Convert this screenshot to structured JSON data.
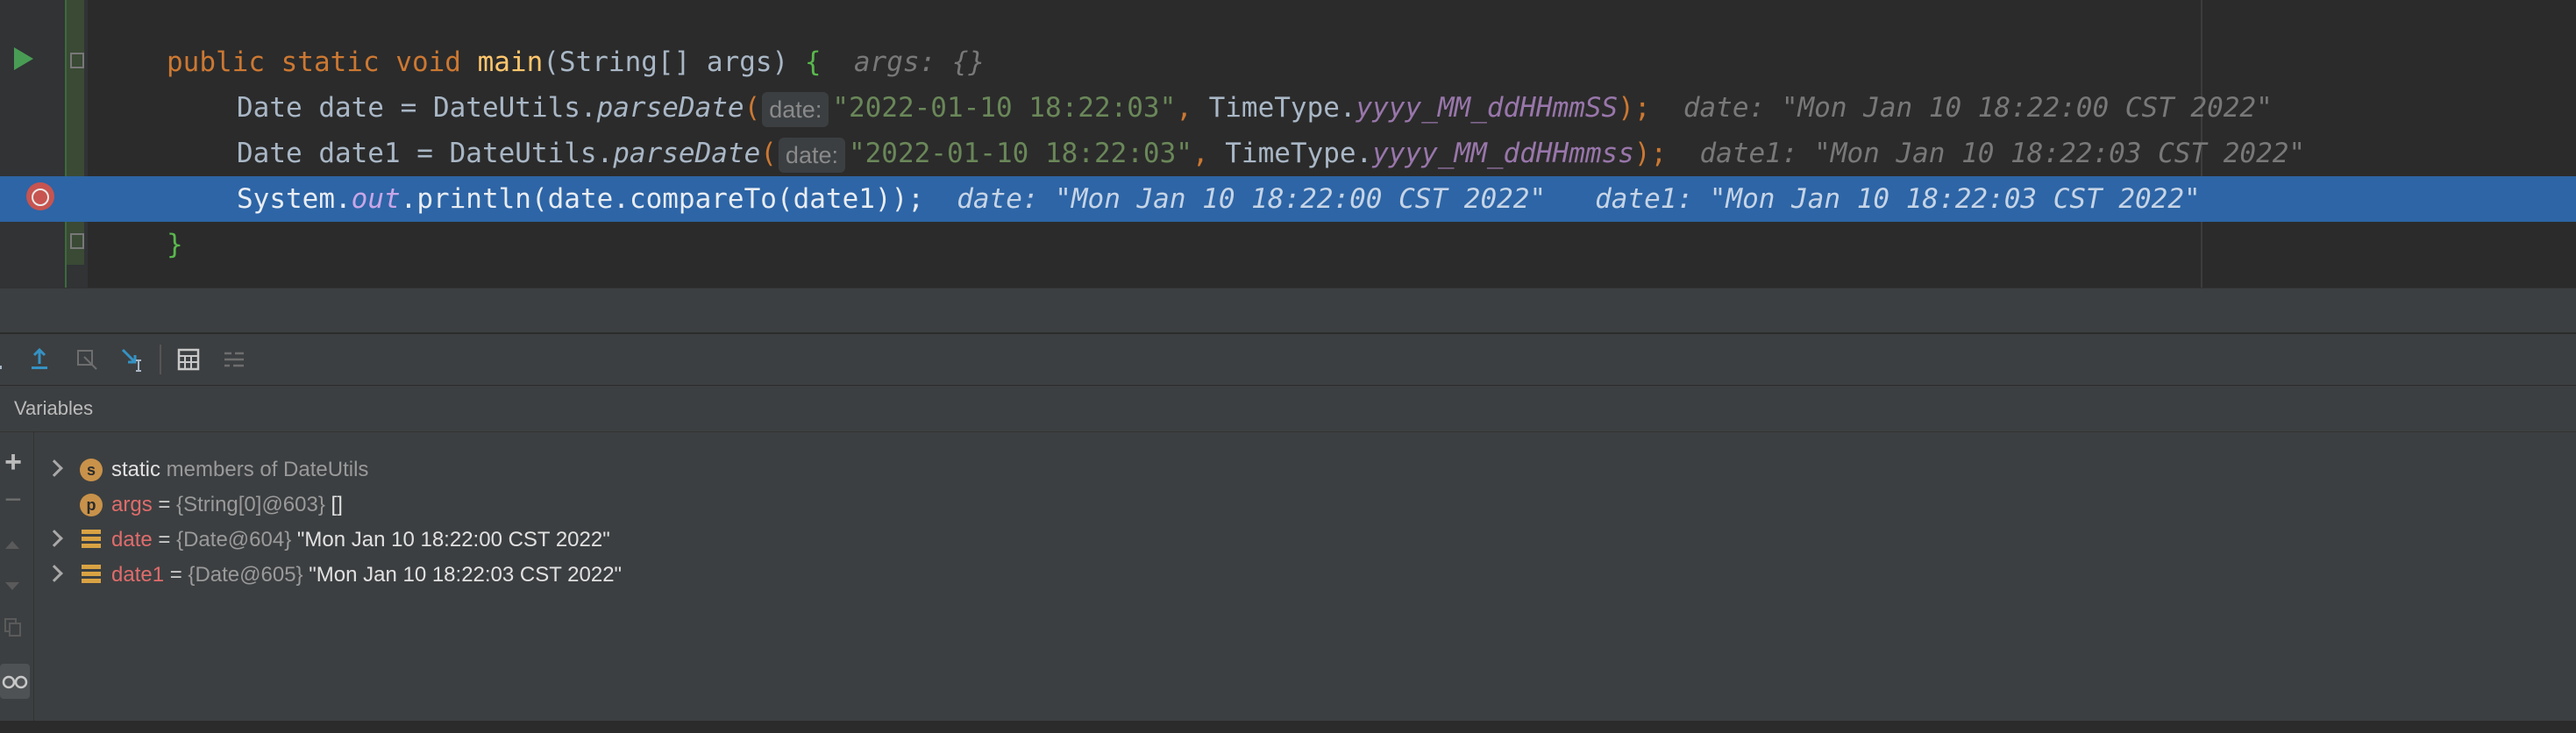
{
  "editor": {
    "lines": [
      {
        "kw1": "public static void ",
        "fn": "main",
        "rest1": "(String[] args) ",
        "brace": "{",
        "hint": "args: {}"
      },
      {
        "prefix": "Date date = DateUtils.",
        "method": "parseDate",
        "paren_open": "(",
        "param_hint": "date:",
        "str": "\"2022-01-10 18:22:03\"",
        "comma": ", ",
        "type": "TimeType.",
        "const": "yyyy_MM_ddHHmmSS",
        "end": ");",
        "hint": "date: \"Mon Jan 10 18:22:00 CST 2022\""
      },
      {
        "prefix": "Date date1 = DateUtils.",
        "method": "parseDate",
        "paren_open": "(",
        "param_hint": "date:",
        "str": "\"2022-01-10 18:22:03\"",
        "comma": ", ",
        "type": "TimeType.",
        "const": "yyyy_MM_ddHHmmss",
        "end": ");",
        "hint": "date1: \"Mon Jan 10 18:22:03 CST 2022\""
      },
      {
        "prefix": "System.",
        "field": "out",
        "call": ".println(date.compareTo(date1));",
        "hint1": "date: \"Mon Jan 10 18:22:00 CST 2022\"",
        "hint2": "date1: \"Mon Jan 10 18:22:03 CST 2022\""
      },
      {
        "brace": "}"
      }
    ]
  },
  "variables_panel": {
    "title": "Variables",
    "side_buttons": {
      "add": "+",
      "remove": "−"
    },
    "items": [
      {
        "icon": "s",
        "name": "static",
        "rest": " members of DateUtils",
        "expandable": true
      },
      {
        "icon": "p",
        "name": "args",
        "eq": " = ",
        "type": "{String[0]@603}",
        "value": " []",
        "expandable": false
      },
      {
        "icon": "field",
        "name": "date",
        "eq": " = ",
        "type": "{Date@604}",
        "value": " \"Mon Jan 10 18:22:00 CST 2022\"",
        "expandable": true
      },
      {
        "icon": "field",
        "name": "date1",
        "eq": " = ",
        "type": "{Date@605}",
        "value": " \"Mon Jan 10 18:22:03 CST 2022\"",
        "expandable": true
      }
    ]
  },
  "colors": {
    "editor_bg": "#2b2b2b",
    "highlight_line": "#2d65a6",
    "keyword": "#cc7832",
    "function": "#ffc66d",
    "string": "#6a8759",
    "constant": "#9876aa",
    "breakpoint": "#c75450",
    "panel_bg": "#3c3f41"
  },
  "icons": [
    "run-icon",
    "fold-icon",
    "breakpoint-icon",
    "step-over-icon",
    "step-out-icon",
    "drop-frame-icon",
    "run-to-cursor-icon",
    "evaluate-expression-icon",
    "trace-icon",
    "add-watch-icon",
    "remove-watch-icon",
    "move-up-icon",
    "move-down-icon",
    "copy-icon",
    "glasses-icon"
  ]
}
